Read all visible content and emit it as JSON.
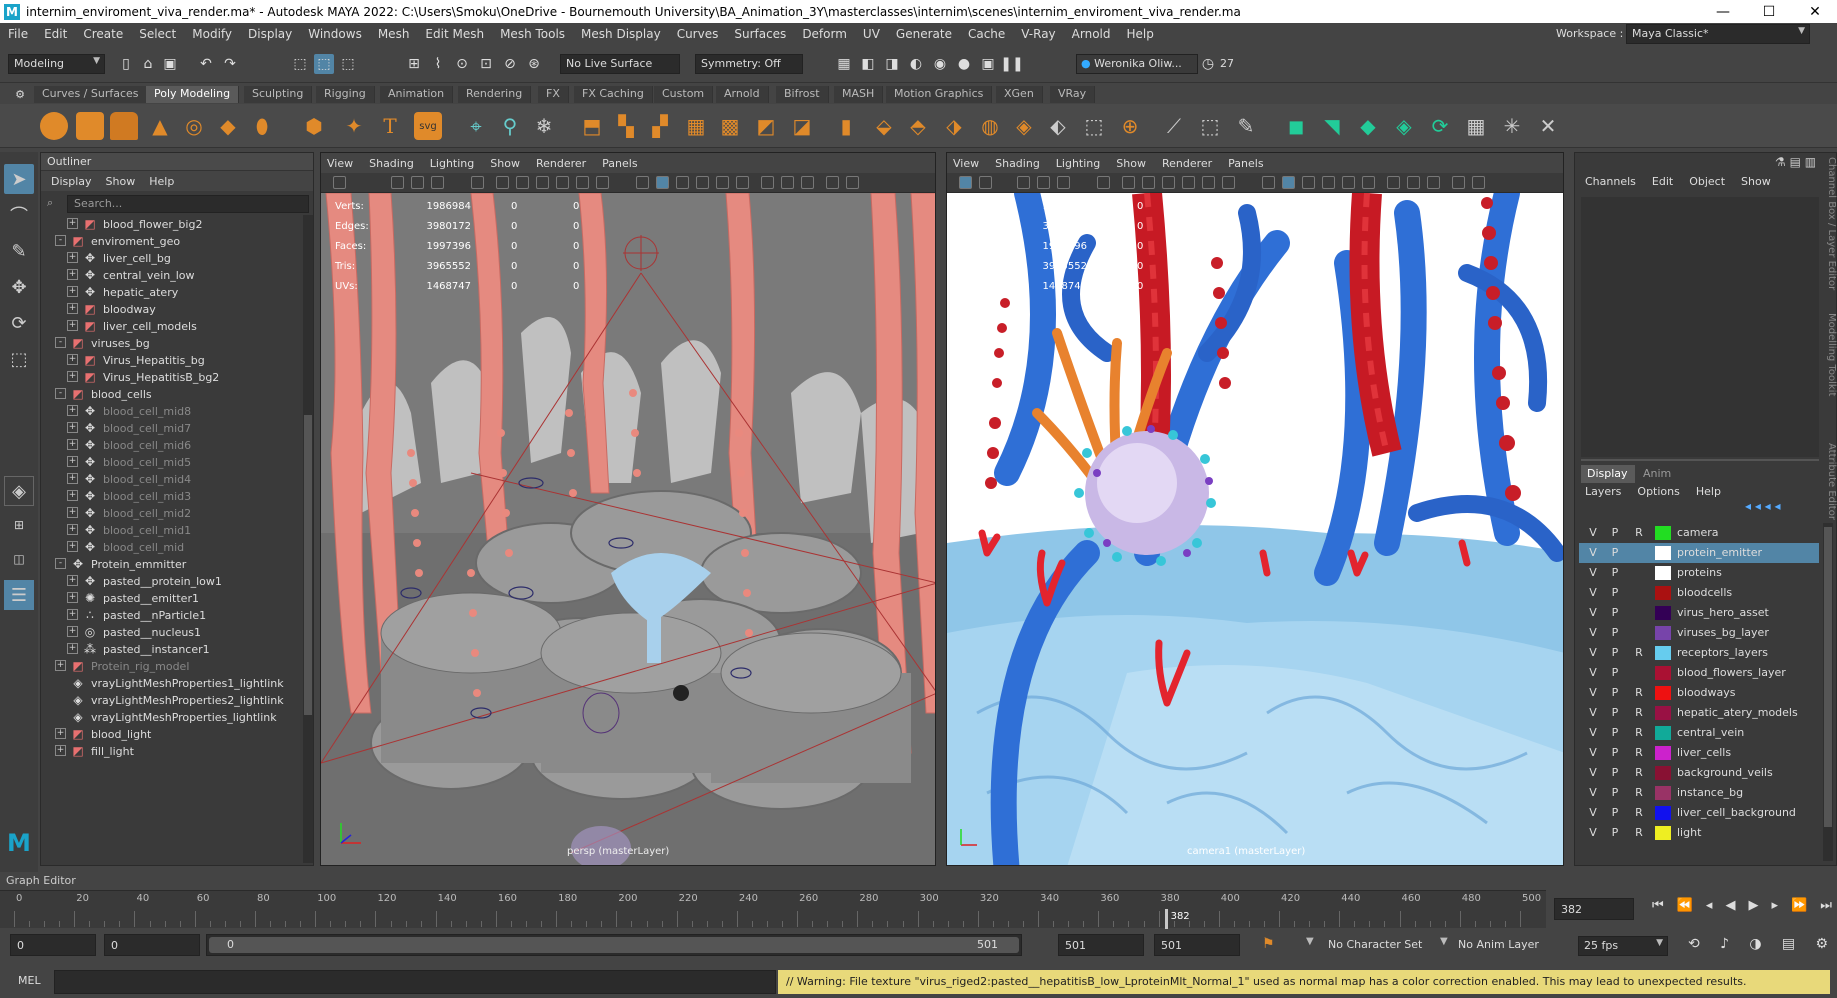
{
  "title": "internim_enviroment_viva_render.ma* - Autodesk MAYA 2022: C:\\Users\\Smoku\\OneDrive - Bournemouth University\\BA_Animation_3Y\\masterclasses\\internim\\scenes\\internim_enviroment_viva_render.ma",
  "menu": [
    "File",
    "Edit",
    "Create",
    "Select",
    "Modify",
    "Display",
    "Windows",
    "Mesh",
    "Edit Mesh",
    "Mesh Tools",
    "Mesh Display",
    "Curves",
    "Surfaces",
    "Deform",
    "UV",
    "Generate",
    "Cache",
    "V-Ray",
    "Arnold",
    "Help"
  ],
  "workspace": {
    "label": "Workspace :",
    "value": "Maya Classic*"
  },
  "status": {
    "mode": "Modeling",
    "live_surface": "No Live Surface",
    "symmetry": "Symmetry: Off",
    "user": "Weronika Oliw...",
    "notifications": "27"
  },
  "shelf_tabs": [
    "Curves / Surfaces",
    "Poly Modeling",
    "Sculpting",
    "Rigging",
    "Animation",
    "Rendering",
    "FX",
    "FX Caching",
    "Custom",
    "Arnold",
    "Bifrost",
    "MASH",
    "Motion Graphics",
    "XGen",
    "VRay"
  ],
  "shelf_active": "Poly Modeling",
  "outliner": {
    "title": "Outliner",
    "menu": [
      "Display",
      "Show",
      "Help"
    ],
    "search_placeholder": "Search...",
    "items": [
      {
        "label": "blood_flower_big2",
        "indent": 1,
        "expand": "+",
        "icon": "mesh",
        "dim": false
      },
      {
        "label": "enviroment_geo",
        "indent": 0,
        "expand": "-",
        "icon": "group",
        "dim": false
      },
      {
        "label": "liver_cell_bg",
        "indent": 1,
        "expand": "+",
        "icon": "transform",
        "dim": false
      },
      {
        "label": "central_vein_low",
        "indent": 1,
        "expand": "+",
        "icon": "transform",
        "dim": false
      },
      {
        "label": "hepatic_atery",
        "indent": 1,
        "expand": "+",
        "icon": "transform",
        "dim": false
      },
      {
        "label": "bloodway",
        "indent": 1,
        "expand": "+",
        "icon": "mesh",
        "dim": false
      },
      {
        "label": "liver_cell_models",
        "indent": 1,
        "expand": "+",
        "icon": "mesh",
        "dim": false
      },
      {
        "label": "viruses_bg",
        "indent": 0,
        "expand": "-",
        "icon": "group",
        "dim": false
      },
      {
        "label": "Virus_Hepatitis_bg",
        "indent": 1,
        "expand": "+",
        "icon": "mesh",
        "dim": false
      },
      {
        "label": "Virus_HepatitisB_bg2",
        "indent": 1,
        "expand": "+",
        "icon": "mesh",
        "dim": false
      },
      {
        "label": "blood_cells",
        "indent": 0,
        "expand": "-",
        "icon": "group",
        "dim": false
      },
      {
        "label": "blood_cell_mid8",
        "indent": 1,
        "expand": "+",
        "icon": "transform",
        "dim": true
      },
      {
        "label": "blood_cell_mid7",
        "indent": 1,
        "expand": "+",
        "icon": "transform",
        "dim": true
      },
      {
        "label": "blood_cell_mid6",
        "indent": 1,
        "expand": "+",
        "icon": "transform",
        "dim": true
      },
      {
        "label": "blood_cell_mid5",
        "indent": 1,
        "expand": "+",
        "icon": "transform",
        "dim": true
      },
      {
        "label": "blood_cell_mid4",
        "indent": 1,
        "expand": "+",
        "icon": "transform",
        "dim": true
      },
      {
        "label": "blood_cell_mid3",
        "indent": 1,
        "expand": "+",
        "icon": "transform",
        "dim": true
      },
      {
        "label": "blood_cell_mid2",
        "indent": 1,
        "expand": "+",
        "icon": "transform",
        "dim": true
      },
      {
        "label": "blood_cell_mid1",
        "indent": 1,
        "expand": "+",
        "icon": "transform",
        "dim": true
      },
      {
        "label": "blood_cell_mid",
        "indent": 1,
        "expand": "+",
        "icon": "transform",
        "dim": true
      },
      {
        "label": "Protein_emmitter",
        "indent": 0,
        "expand": "-",
        "icon": "transform",
        "dim": false
      },
      {
        "label": "pasted__protein_low1",
        "indent": 1,
        "expand": "+",
        "icon": "transform",
        "dim": false
      },
      {
        "label": "pasted__emitter1",
        "indent": 1,
        "expand": "+",
        "icon": "emitter",
        "dim": false
      },
      {
        "label": "pasted__nParticle1",
        "indent": 1,
        "expand": "+",
        "icon": "particle",
        "dim": false
      },
      {
        "label": "pasted__nucleus1",
        "indent": 1,
        "expand": "+",
        "icon": "nucleus",
        "dim": false
      },
      {
        "label": "pasted__instancer1",
        "indent": 1,
        "expand": "+",
        "icon": "instancer",
        "dim": false
      },
      {
        "label": "Protein_rig_model",
        "indent": 0,
        "expand": "+",
        "icon": "group",
        "dim": true
      },
      {
        "label": "vrayLightMeshProperties1_lightlink",
        "indent": 0,
        "expand": "",
        "icon": "light",
        "dim": false
      },
      {
        "label": "vrayLightMeshProperties2_lightlink",
        "indent": 0,
        "expand": "",
        "icon": "light",
        "dim": false
      },
      {
        "label": "vrayLightMeshProperties_lightlink",
        "indent": 0,
        "expand": "",
        "icon": "light",
        "dim": false
      },
      {
        "label": "blood_light",
        "indent": 0,
        "expand": "+",
        "icon": "group",
        "dim": false
      },
      {
        "label": "fill_light",
        "indent": 0,
        "expand": "+",
        "icon": "group",
        "dim": false
      }
    ]
  },
  "viewport_menu": [
    "View",
    "Shading",
    "Lighting",
    "Show",
    "Renderer",
    "Panels"
  ],
  "hud": {
    "labels": [
      "Verts:",
      "Edges:",
      "Faces:",
      "Tris:",
      "UVs:"
    ],
    "values": [
      "1986984",
      "3980172",
      "1997396",
      "3965552",
      "1468747"
    ],
    "zero": "0"
  },
  "viewport_left": {
    "camera": "persp (masterLayer)"
  },
  "viewport_right": {
    "camera": "camera1 (masterLayer)"
  },
  "channelbox": {
    "menu": [
      "Channels",
      "Edit",
      "Object",
      "Show"
    ],
    "side_tabs": [
      "Channel Box / Layer Editor",
      "Modelling Toolkit",
      "Attribute Editor"
    ],
    "layer_tabs": [
      "Display",
      "Anim"
    ],
    "layer_menu": [
      "Layers",
      "Options",
      "Help"
    ],
    "layers": [
      {
        "name": "camera",
        "color": "#22dd22",
        "r": true,
        "sel": false
      },
      {
        "name": "protein_emitter",
        "color": "#ffffff",
        "r": false,
        "sel": true
      },
      {
        "name": "proteins",
        "color": "#ffffff",
        "r": false,
        "sel": false
      },
      {
        "name": "bloodcells",
        "color": "#aa1111",
        "r": false,
        "sel": false
      },
      {
        "name": "virus_hero_asset",
        "color": "#330055",
        "r": false,
        "sel": false
      },
      {
        "name": "viruses_bg_layer",
        "color": "#7744aa",
        "r": false,
        "sel": false
      },
      {
        "name": "receptors_layers",
        "color": "#66ccee",
        "r": true,
        "sel": false
      },
      {
        "name": "blood_flowers_layer",
        "color": "#aa1133",
        "r": false,
        "sel": false
      },
      {
        "name": "bloodways",
        "color": "#ee1111",
        "r": true,
        "sel": false
      },
      {
        "name": "hepatic_atery_models",
        "color": "#991144",
        "r": true,
        "sel": false
      },
      {
        "name": "central_vein",
        "color": "#11aa99",
        "r": true,
        "sel": false
      },
      {
        "name": "liver_cells",
        "color": "#cc22cc",
        "r": true,
        "sel": false
      },
      {
        "name": "background_veils",
        "color": "#881133",
        "r": true,
        "sel": false
      },
      {
        "name": "instance_bg",
        "color": "#993366",
        "r": true,
        "sel": false
      },
      {
        "name": "liver_cell_background",
        "color": "#1111ee",
        "r": true,
        "sel": false
      },
      {
        "name": "light",
        "color": "#eeee22",
        "r": true,
        "sel": false
      }
    ],
    "v": "V",
    "p": "P",
    "r": "R"
  },
  "graph_editor_label": "Graph Editor",
  "timeline": {
    "ticks": [
      "0",
      "20",
      "40",
      "60",
      "80",
      "100",
      "120",
      "140",
      "160",
      "180",
      "200",
      "220",
      "240",
      "260",
      "280",
      "300",
      "320",
      "340",
      "360",
      "380",
      "400",
      "420",
      "440",
      "460",
      "480",
      "500"
    ],
    "current_frame": 382,
    "current_label": "382",
    "frame_field": "382",
    "end": 501
  },
  "range": {
    "start": "0",
    "start2": "0",
    "slider_start": "0",
    "slider_end": "501",
    "end": "501",
    "end2": "501",
    "character_set": "No Character Set",
    "anim_layer": "No Anim Layer",
    "fps": "25 fps"
  },
  "cmdline": {
    "label": "MEL",
    "warning": "// Warning: File texture \"virus_riged2:pasted__hepatitisB_low_LproteinMlt_Normal_1\" used as normal map has a color correction enabled. This may lead to unexpected results."
  }
}
